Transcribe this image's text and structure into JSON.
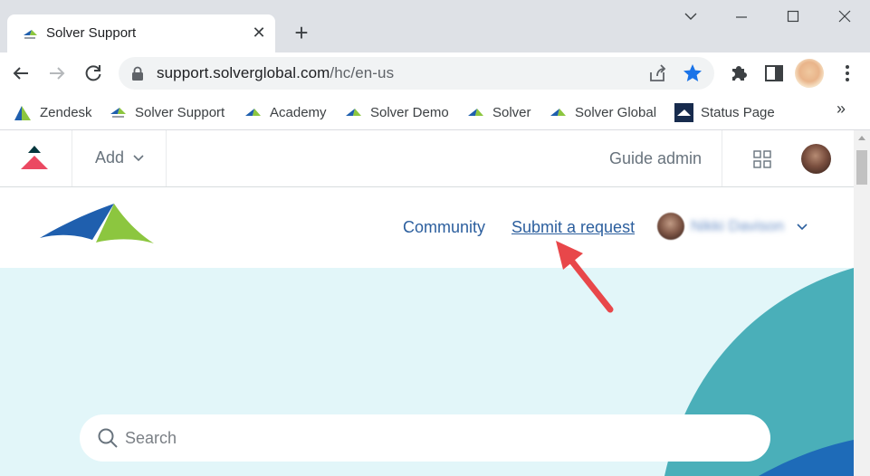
{
  "browser": {
    "tab": {
      "title": "Solver Support",
      "close_glyph": "✕"
    },
    "new_tab_glyph": "+",
    "url": {
      "host": "support.solverglobal.com",
      "path": "/hc/en-us"
    },
    "bookmarks": [
      {
        "label": "Zendesk",
        "icon": "zendesk-icon"
      },
      {
        "label": "Solver Support",
        "icon": "solver-icon"
      },
      {
        "label": "Academy",
        "icon": "solver-icon"
      },
      {
        "label": "Solver Demo",
        "icon": "solver-icon"
      },
      {
        "label": "Solver",
        "icon": "solver-icon"
      },
      {
        "label": "Solver Global",
        "icon": "solver-icon"
      },
      {
        "label": "Status Page",
        "icon": "statuspage-icon"
      }
    ],
    "bookmarks_more_glyph": "»",
    "colors": {
      "star": "#1a73e8",
      "chrome_bg": "#dee1e6"
    }
  },
  "zendesk_bar": {
    "add_label": "Add",
    "guide_admin_label": "Guide admin"
  },
  "help_center": {
    "nav": {
      "community": "Community",
      "submit_request": "Submit a request",
      "user_name": "Nikki Davison"
    },
    "search": {
      "placeholder": "Search"
    },
    "colors": {
      "link": "#2c5f9e",
      "hero_bg": "#e2f6f9",
      "hero_teal": "#4aafb9",
      "hero_blue": "#1e6bb8",
      "logo_blue": "#1f5fae",
      "logo_green": "#8cc63f",
      "annotation_arrow": "#e8474a"
    }
  }
}
